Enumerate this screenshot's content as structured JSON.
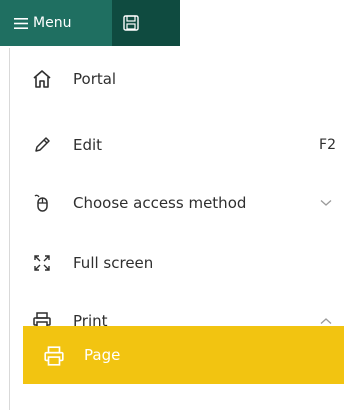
{
  "toolbar": {
    "menu_label": "Menu",
    "menu_icon": "hamburger-icon",
    "save_icon": "save-icon"
  },
  "menu": {
    "items": [
      {
        "label": "Portal",
        "icon": "home-icon"
      },
      {
        "label": "Edit",
        "icon": "pencil-icon",
        "shortcut": "F2"
      },
      {
        "label": "Choose access method",
        "icon": "mouse-icon",
        "chevron": "down"
      },
      {
        "label": "Full screen",
        "icon": "fullscreen-icon"
      },
      {
        "label": "Print",
        "icon": "printer-icon",
        "chevron": "up",
        "expanded": true
      }
    ],
    "print_submenu": [
      {
        "label": "Page",
        "icon": "printer-icon"
      }
    ]
  },
  "colors": {
    "menu_tab_bg": "#1f6f61",
    "save_tab_bg": "#0f4b40",
    "highlight_bg": "#f2c411",
    "highlight_text": "#ffffff"
  }
}
